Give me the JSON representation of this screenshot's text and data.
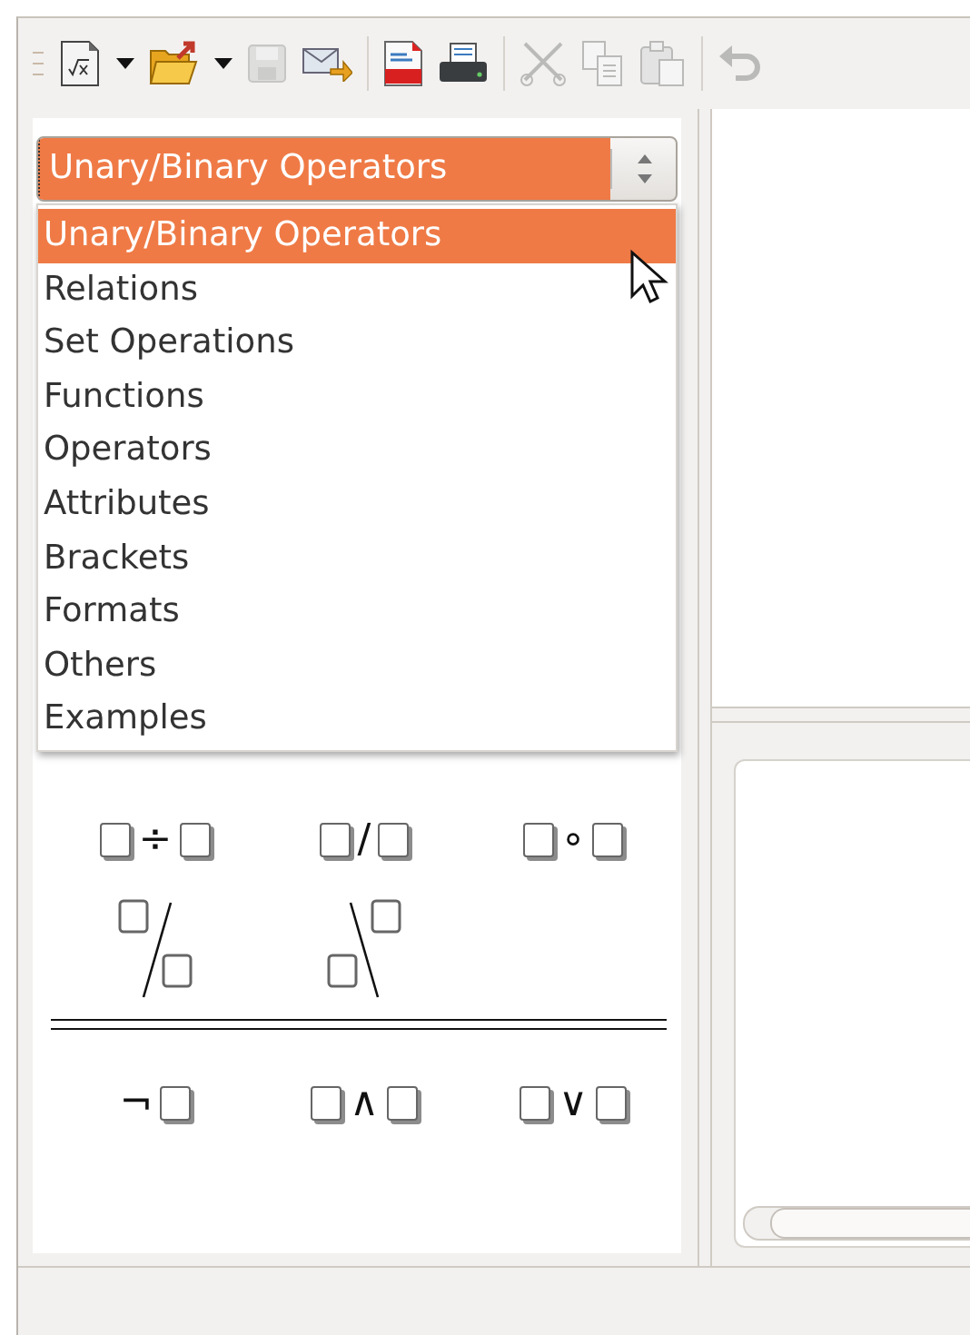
{
  "toolbar": [
    {
      "kind": "formula-doc",
      "disabled": false
    },
    {
      "kind": "dropdown",
      "disabled": false
    },
    {
      "kind": "open-folder",
      "disabled": false
    },
    {
      "kind": "dropdown",
      "disabled": false
    },
    {
      "kind": "save",
      "disabled": true
    },
    {
      "kind": "mail",
      "disabled": false
    },
    {
      "kind": "separator"
    },
    {
      "kind": "pdf",
      "disabled": false
    },
    {
      "kind": "print",
      "disabled": false
    },
    {
      "kind": "separator"
    },
    {
      "kind": "cut",
      "disabled": true
    },
    {
      "kind": "copy",
      "disabled": true
    },
    {
      "kind": "paste",
      "disabled": true
    },
    {
      "kind": "separator"
    },
    {
      "kind": "undo",
      "disabled": true
    }
  ],
  "category_select": {
    "value": "Unary/Binary Operators",
    "options": [
      {
        "label": "Unary/Binary Operators",
        "selected": true
      },
      {
        "label": "Relations",
        "selected": false
      },
      {
        "label": "Set Operations",
        "selected": false
      },
      {
        "label": "Functions",
        "selected": false
      },
      {
        "label": "Operators",
        "selected": false
      },
      {
        "label": "Attributes",
        "selected": false
      },
      {
        "label": "Brackets",
        "selected": false
      },
      {
        "label": "Formats",
        "selected": false
      },
      {
        "label": "Others",
        "selected": false
      },
      {
        "label": "Examples",
        "selected": false
      }
    ]
  },
  "symbols": [
    {
      "kind": "binary",
      "operator": "÷"
    },
    {
      "kind": "binary",
      "operator": "/"
    },
    {
      "kind": "binary",
      "operator": "∘"
    },
    {
      "kind": "slash-fraction"
    },
    {
      "kind": "backslash-fraction"
    },
    {
      "kind": "rule"
    },
    {
      "kind": "unary",
      "operator": "¬"
    },
    {
      "kind": "binary",
      "operator": "∧"
    },
    {
      "kind": "binary",
      "operator": "∨"
    }
  ]
}
